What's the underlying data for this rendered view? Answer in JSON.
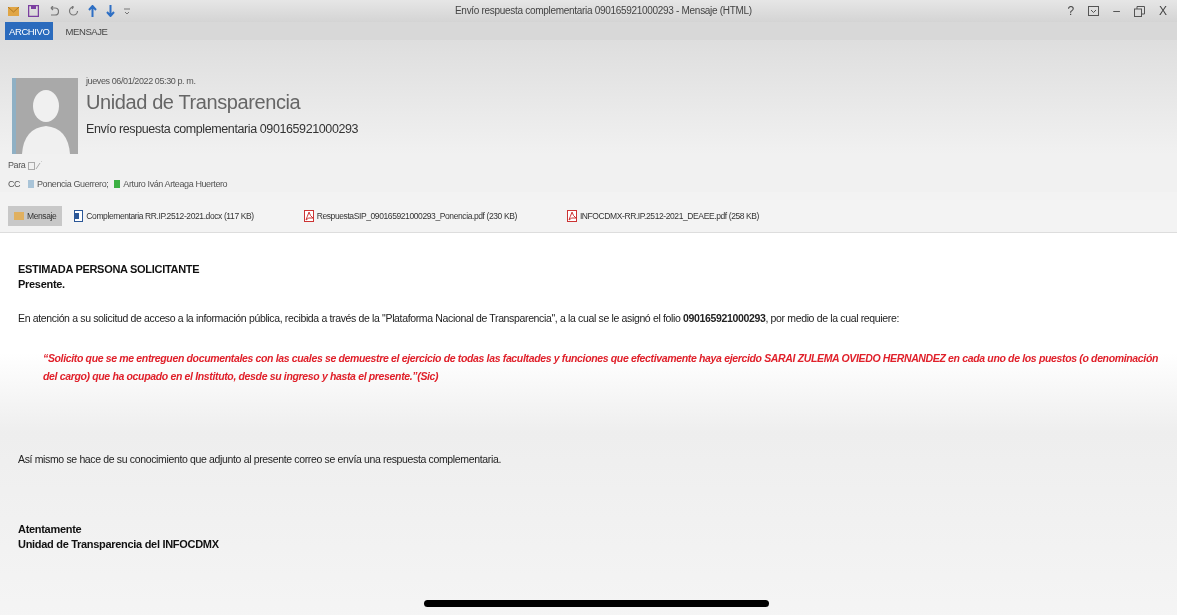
{
  "window": {
    "title": "Envío respuesta complementaria 090165921000293 - Mensaje (HTML)",
    "controls": [
      {
        "kind": "help",
        "label": "?"
      },
      {
        "kind": "ribbon"
      },
      {
        "kind": "minimize",
        "label": "–"
      },
      {
        "kind": "restore"
      },
      {
        "kind": "close",
        "label": "X"
      }
    ]
  },
  "tabs": [
    {
      "label": "ARCHIVO",
      "selected": true
    },
    {
      "label": "MENSAJE",
      "selected": false
    }
  ],
  "header": {
    "date": "jueves 06/01/2022 05:30 p. m.",
    "sender": "Unidad de Transparencia",
    "subject": "Envío respuesta complementaria 090165921000293",
    "to_label": "Para",
    "cc_label": "CC",
    "cc": [
      {
        "name": "Ponencia Guerrero;",
        "color": "#a9c4d8"
      },
      {
        "name": "Arturo Iván Arteaga Huertero",
        "color": "#3cb043"
      }
    ]
  },
  "attachments": [
    {
      "kind": "message",
      "label": "Mensaje",
      "selected": true
    },
    {
      "kind": "docx",
      "label": "Complementaria RR.IP.2512-2021.docx (117 KB)",
      "selected": false
    },
    {
      "kind": "pdf",
      "label": "RespuestaSIP_090165921000293_Ponencia.pdf (230 KB)",
      "selected": false
    },
    {
      "kind": "pdf",
      "label": "INFOCDMX-RR.IP.2512-2021_DEAEE.pdf (258 KB)",
      "selected": false
    }
  ],
  "body": {
    "greeting": [
      "ESTIMADA PERSONA SOLICITANTE",
      "Presente."
    ],
    "intro": "En atención a su solicitud de acceso a la información pública, recibida a través de la \"Plataforma Nacional de Transparencia\", a la cual se le asignó el folio **090165921000293**, por medio de la cual requiere:",
    "quote": "“Solicito que se me entreguen documentales con las cuales se demuestre el ejercicio de todas las facultades y funciones que efectivamente haya ejercido SARAI ZULEMA OVIEDO HERNANDEZ en cada uno de los puestos (o denominación del cargo) que ha ocupado en el Instituto, desde su ingreso y hasta el presente.”(Sic)",
    "notice": "Así mismo se hace de su conocimiento que adjunto al presente correo se envía una respuesta complementaria.",
    "closing": [
      "Atentamente",
      "Unidad de Transparencia del INFOCDMX"
    ]
  }
}
